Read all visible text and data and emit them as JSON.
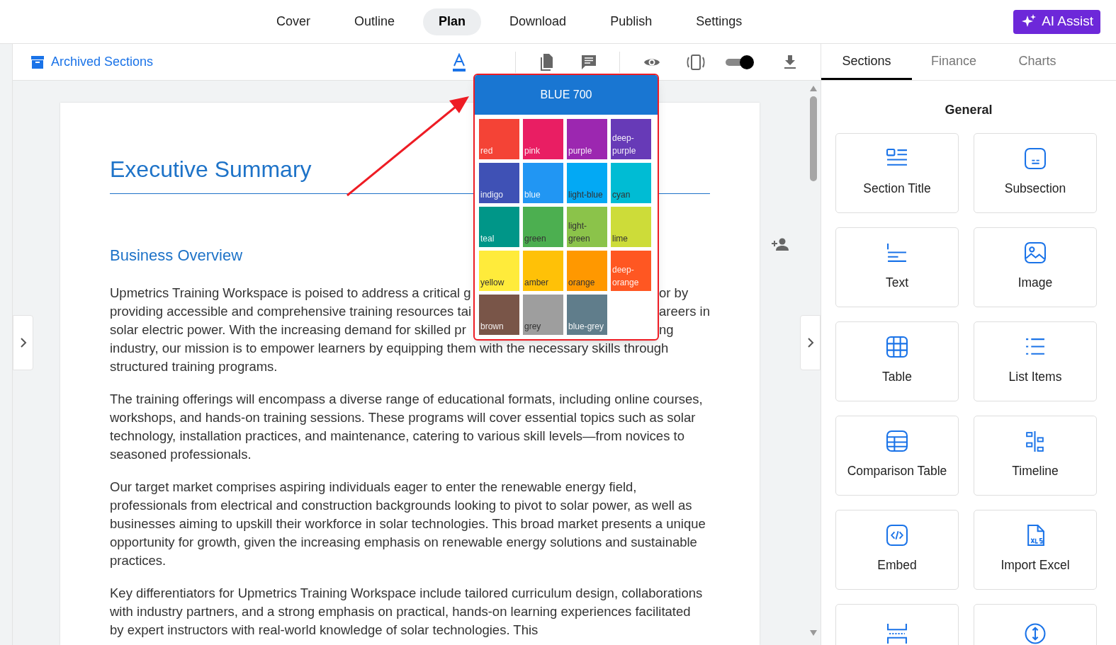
{
  "nav": {
    "items": [
      {
        "label": "Cover",
        "selected": false
      },
      {
        "label": "Outline",
        "selected": false
      },
      {
        "label": "Plan",
        "selected": true
      },
      {
        "label": "Download",
        "selected": false
      },
      {
        "label": "Publish",
        "selected": false
      },
      {
        "label": "Settings",
        "selected": false
      }
    ],
    "assist_button": "AI Assist"
  },
  "toolbar": {
    "archived_link": "Archived Sections",
    "toggle_on": true
  },
  "document": {
    "title": "Executive Summary",
    "heading": "Business Overview",
    "first_paragraph_lines": [
      {
        "left": "Upmetrics Training Workspace is poised to address a critical g",
        "right": "or by"
      },
      {
        "left": "providing accessible and comprehensive training resources tai",
        "right": "areers in"
      },
      {
        "left": "solar electric power. With the increasing demand for skilled pr",
        "right": "ng"
      },
      {
        "left": "industry, our mission is to empower learners by equipping them with the necessary skills through"
      },
      {
        "left": "structured training programs."
      }
    ],
    "paragraphs": [
      "The training offerings will encompass a diverse range of educational formats, including online courses, workshops, and hands-on training sessions. These programs will cover essential topics such as solar technology, installation practices, and maintenance, catering to various skill levels—from novices to seasoned professionals.",
      "Our target market comprises aspiring individuals eager to enter the renewable energy field, professionals from electrical and construction backgrounds looking to pivot to solar power, as well as businesses aiming to upskill their workforce in solar technologies. This broad market presents a unique opportunity for growth, given the increasing emphasis on renewable energy solutions and sustainable practices.",
      "Key differentiators for Upmetrics Training Workspace include tailored curriculum design, collaborations with industry partners, and a strong emphasis on practical, hands-on learning experiences facilitated by expert instructors with real-world knowledge of solar technologies. This"
    ]
  },
  "color_picker": {
    "header": {
      "label": "BLUE 700",
      "color": "#1976d2"
    },
    "swatches": [
      {
        "label": "red",
        "color": "#f44336"
      },
      {
        "label": "pink",
        "color": "#e91e63"
      },
      {
        "label": "purple",
        "color": "#9c27b0"
      },
      {
        "label": "deep-purple",
        "color": "#673ab7"
      },
      {
        "label": "indigo",
        "color": "#3f51b5"
      },
      {
        "label": "blue",
        "color": "#2196f3"
      },
      {
        "label": "light-blue",
        "color": "#03a9f4"
      },
      {
        "label": "cyan",
        "color": "#00bcd4"
      },
      {
        "label": "teal",
        "color": "#009688"
      },
      {
        "label": "green",
        "color": "#4caf50"
      },
      {
        "label": "light-green",
        "color": "#8bc34a"
      },
      {
        "label": "lime",
        "color": "#cddc39"
      },
      {
        "label": "yellow",
        "color": "#ffeb3b"
      },
      {
        "label": "amber",
        "color": "#ffc107"
      },
      {
        "label": "orange",
        "color": "#ff9800"
      },
      {
        "label": "deep-orange",
        "color": "#ff5722"
      },
      {
        "label": "brown",
        "color": "#795548"
      },
      {
        "label": "grey",
        "color": "#9e9e9e"
      },
      {
        "label": "blue-grey",
        "color": "#607d8b"
      }
    ]
  },
  "panel": {
    "tabs": [
      {
        "label": "Sections",
        "selected": true
      },
      {
        "label": "Finance",
        "selected": false
      },
      {
        "label": "Charts",
        "selected": false
      }
    ],
    "group_title": "General",
    "cards": [
      {
        "label": "Section Title"
      },
      {
        "label": "Subsection"
      },
      {
        "label": "Text"
      },
      {
        "label": "Image"
      },
      {
        "label": "Table"
      },
      {
        "label": "List Items"
      },
      {
        "label": "Comparison Table"
      },
      {
        "label": "Timeline"
      },
      {
        "label": "Embed"
      },
      {
        "label": "Import Excel"
      }
    ]
  }
}
